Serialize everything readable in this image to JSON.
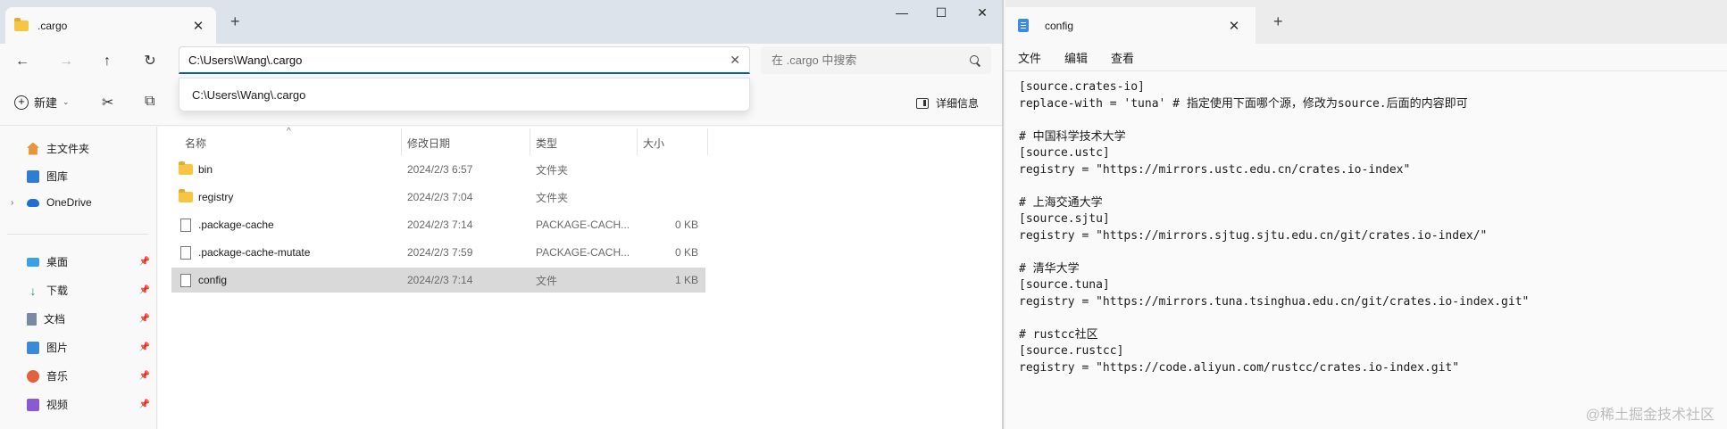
{
  "explorer": {
    "tab_title": ".cargo",
    "window_controls": {
      "minimize": "—",
      "maximize": "☐",
      "close": "✕"
    },
    "nav": {
      "back": "←",
      "forward": "→",
      "up": "↑",
      "refresh": "↻"
    },
    "address_value": "C:\\Users\\Wang\\.cargo",
    "address_suggestion": "C:\\Users\\Wang\\.cargo",
    "search_placeholder": "在 .cargo 中搜索",
    "toolbar": {
      "new_label": "新建",
      "details_label": "详细信息"
    },
    "sidebar": {
      "home": "主文件夹",
      "gallery": "图库",
      "onedrive": "OneDrive",
      "quick": [
        {
          "label": "桌面"
        },
        {
          "label": "下载"
        },
        {
          "label": "文档"
        },
        {
          "label": "图片"
        },
        {
          "label": "音乐"
        },
        {
          "label": "视频"
        }
      ]
    },
    "columns": {
      "name": "名称",
      "date": "修改日期",
      "type": "类型",
      "size": "大小"
    },
    "files": [
      {
        "name": "bin",
        "date": "2024/2/3 6:57",
        "type": "文件夹",
        "size": "",
        "kind": "folder"
      },
      {
        "name": "registry",
        "date": "2024/2/3 7:04",
        "type": "文件夹",
        "size": "",
        "kind": "folder"
      },
      {
        "name": ".package-cache",
        "date": "2024/2/3 7:14",
        "type": "PACKAGE-CACH...",
        "size": "0 KB",
        "kind": "file"
      },
      {
        "name": ".package-cache-mutate",
        "date": "2024/2/3 7:59",
        "type": "PACKAGE-CACH...",
        "size": "0 KB",
        "kind": "file"
      },
      {
        "name": "config",
        "date": "2024/2/3 7:14",
        "type": "文件",
        "size": "1 KB",
        "kind": "file",
        "selected": true
      }
    ]
  },
  "notepad": {
    "tab_title": "config",
    "menu": [
      "文件",
      "编辑",
      "查看"
    ],
    "lines": [
      "[source.crates-io]",
      "replace-with = 'tuna' # 指定使用下面哪个源，修改为source.后面的内容即可",
      "",
      "# 中国科学技术大学",
      "[source.ustc]",
      "registry = \"https://mirrors.ustc.edu.cn/crates.io-index\"",
      "",
      "# 上海交通大学",
      "[source.sjtu]",
      "registry = \"https://mirrors.sjtug.sjtu.edu.cn/git/crates.io-index/\"",
      "",
      "# 清华大学",
      "[source.tuna]",
      "registry = \"https://mirrors.tuna.tsinghua.edu.cn/git/crates.io-index.git\"",
      "",
      "# rustcc社区",
      "[source.rustcc]",
      "registry = \"https://code.aliyun.com/rustcc/crates.io-index.git\""
    ],
    "watermark": "@稀土掘金技术社区"
  }
}
